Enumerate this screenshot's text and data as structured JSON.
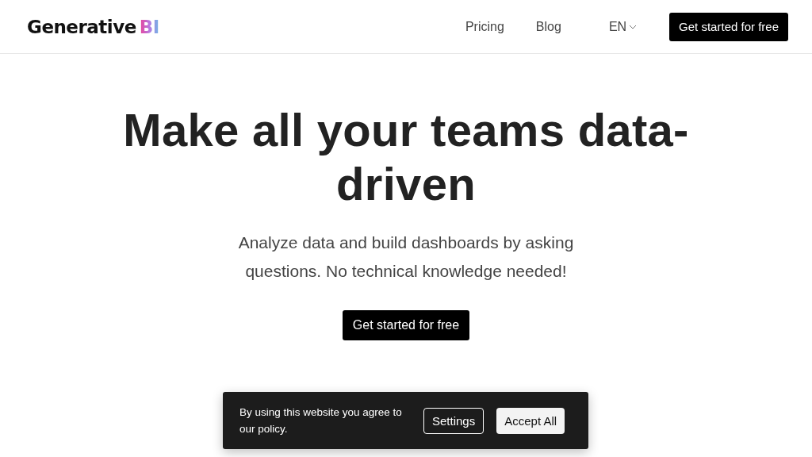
{
  "header": {
    "logo": {
      "text": "Generative",
      "accent": "BI"
    },
    "nav": [
      "Pricing",
      "Blog"
    ],
    "language": "EN",
    "cta": "Get started for free"
  },
  "hero": {
    "title": "Make all your teams data-driven",
    "subtitle": "Analyze data and build dashboards by asking questions. No technical knowledge needed!",
    "cta": "Get started for free"
  },
  "cookie_banner": {
    "message": "By using this website you agree to our policy.",
    "buttons": [
      {
        "label": "Settings",
        "kind": "outline"
      },
      {
        "label": "Accept All",
        "kind": "filled"
      }
    ]
  }
}
